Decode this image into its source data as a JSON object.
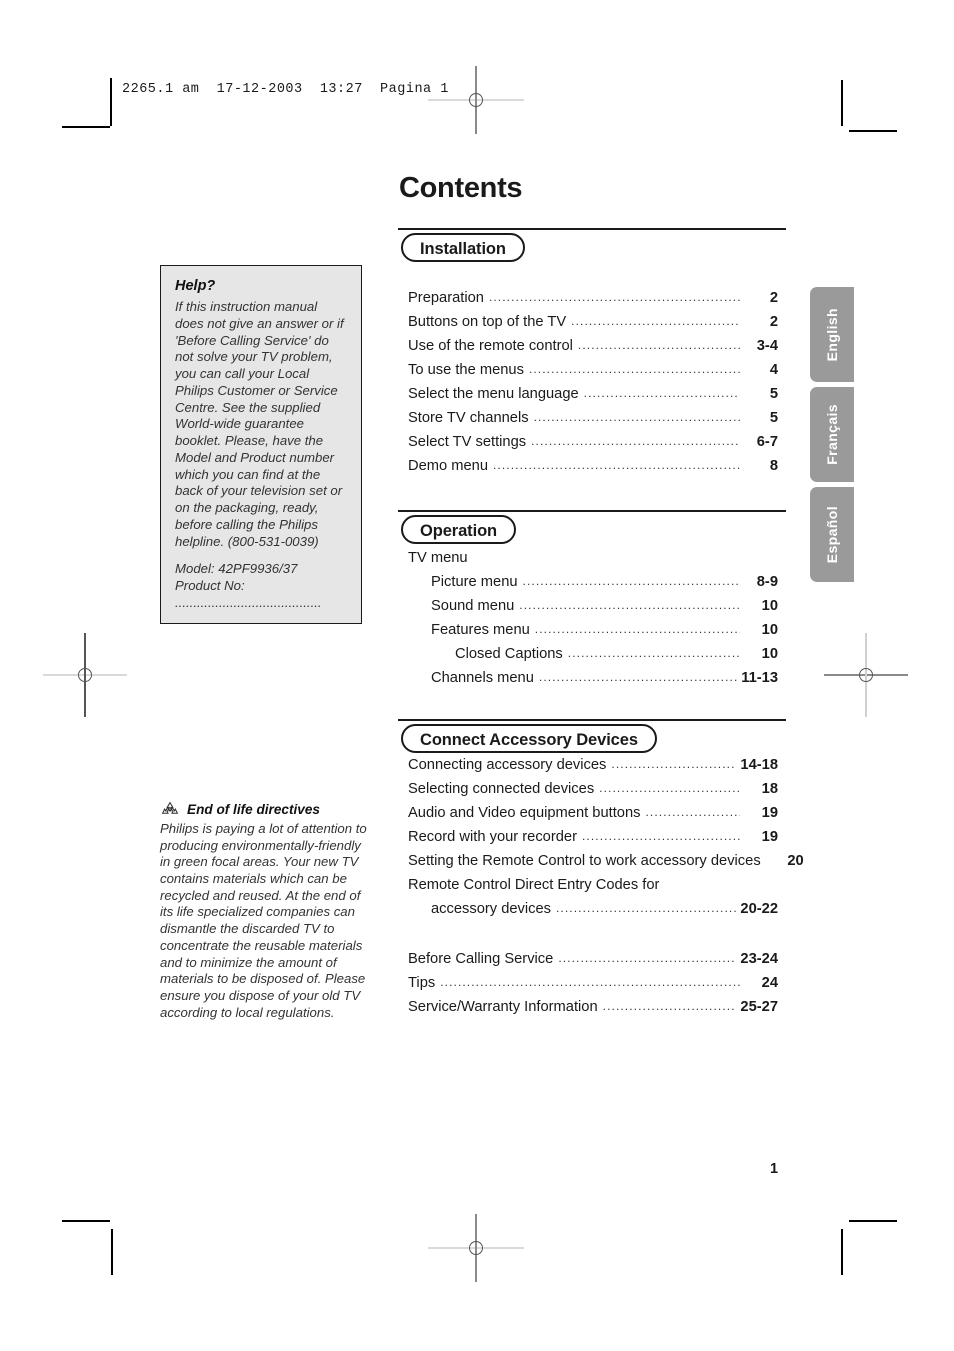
{
  "printer_slug": "2265.1 am  17-12-2003  13:27  Pagina 1",
  "page_title": "Contents",
  "page_number": "1",
  "colors": {
    "tab_background": "#9a9a9a",
    "tab_text": "#ffffff",
    "help_background": "#e6e6e6",
    "ink": "#1a1a1a"
  },
  "help_box": {
    "title": "Help?",
    "body": "If this instruction manual does not give an answer or if 'Before Calling Service' do not solve your TV problem, you can call your Local Philips Customer or Service Centre. See the supplied World-wide guarantee booklet. Please, have the Model and Product number which you can find at the back of your television set or on the packaging, ready, before calling the Philips helpline. (800-531-0039)",
    "model_line": "Model: 42PF9936/37",
    "product_line": "Product No: ........................................"
  },
  "end_of_life": {
    "icon": "recycle-icon",
    "title": "End of life directives",
    "body": "Philips is paying a lot of attention to producing environmentally-friendly in green focal areas. Your new TV contains materials which can be recycled and reused. At the end of its life specialized companies can dismantle the discarded TV to concentrate the reusable materials and to minimize the amount of materials to be disposed of. Please ensure you dispose of your old TV according to local regulations."
  },
  "language_tabs": [
    {
      "label": "English"
    },
    {
      "label": "Français"
    },
    {
      "label": "Español"
    }
  ],
  "sections": [
    {
      "heading": "Installation",
      "entries": [
        {
          "label": "Preparation",
          "page": "2",
          "indent": 0,
          "dots": true
        },
        {
          "label": "Buttons on top of the TV",
          "page": "2",
          "indent": 0,
          "dots": true
        },
        {
          "label": "Use of the remote control",
          "page": "3-4",
          "indent": 0,
          "dots": true
        },
        {
          "label": "To use the menus",
          "page": "4",
          "indent": 0,
          "dots": true
        },
        {
          "label": "Select the menu language",
          "page": "5",
          "indent": 0,
          "dots": true
        },
        {
          "label": "Store TV channels",
          "page": "5",
          "indent": 0,
          "dots": true
        },
        {
          "label": "Select TV settings",
          "page": "6-7",
          "indent": 0,
          "dots": true
        },
        {
          "label": "Demo menu",
          "page": "8",
          "indent": 0,
          "dots": true
        }
      ]
    },
    {
      "heading": "Operation",
      "entries": [
        {
          "label": "TV menu",
          "page": "",
          "indent": 0,
          "dots": false
        },
        {
          "label": "Picture menu",
          "page": "8-9",
          "indent": 1,
          "dots": true
        },
        {
          "label": "Sound menu",
          "page": "10",
          "indent": 1,
          "dots": true
        },
        {
          "label": "Features menu",
          "page": "10",
          "indent": 1,
          "dots": true
        },
        {
          "label": "Closed Captions",
          "page": "10",
          "indent": 2,
          "dots": true
        },
        {
          "label": "Channels menu",
          "page": "11-13",
          "indent": 1,
          "dots": true
        }
      ]
    },
    {
      "heading": "Connect Accessory Devices",
      "entries": [
        {
          "label": "Connecting accessory devices",
          "page": "14-18",
          "indent": 0,
          "dots": true
        },
        {
          "label": "Selecting connected devices",
          "page": "18",
          "indent": 0,
          "dots": true
        },
        {
          "label": "Audio and Video equipment buttons",
          "page": "19",
          "indent": 0,
          "dots": true
        },
        {
          "label": "Record with your recorder",
          "page": "19",
          "indent": 0,
          "dots": true
        },
        {
          "label": "Setting the Remote Control to work accessory devices",
          "page": "20",
          "indent": 0,
          "dots": true
        },
        {
          "label": "Remote Control Direct Entry Codes for",
          "page": "",
          "indent": 0,
          "dots": false
        },
        {
          "label": "accessory devices",
          "page": "20-22",
          "indent": 1,
          "dots": true
        }
      ]
    },
    {
      "heading": "",
      "entries": [
        {
          "label": "Before Calling Service",
          "page": "23-24",
          "indent": 0,
          "dots": true
        },
        {
          "label": "Tips",
          "page": "24",
          "indent": 0,
          "dots": true
        },
        {
          "label": "Service/Warranty Information",
          "page": "25-27",
          "indent": 0,
          "dots": true
        }
      ]
    }
  ]
}
